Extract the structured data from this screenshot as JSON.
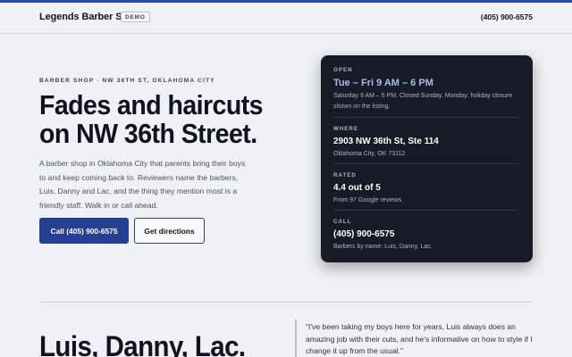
{
  "header": {
    "brand": "Legends Barber Studio",
    "badge": "DEMO",
    "phone": "(405) 900-6575"
  },
  "hero": {
    "eyebrow": "BARBER SHOP · NW 36TH ST, OKLAHOMA CITY",
    "headline": "Fades and haircuts on NW 36th Street.",
    "intro": "A barber shop in Oklahoma City that parents bring their boys to and keep coming back to. Reviewers name the barbers, Luis, Danny and Lac, and the thing they mention most is a friendly staff. Walk in or call ahead.",
    "call_button": "Call (405) 900-6575",
    "directions_button": "Get directions"
  },
  "card": {
    "open": {
      "label": "OPEN",
      "value": "Tue – Fri 9 AM – 6 PM",
      "detail": "Saturday 9 AM – 5 PM. Closed Sunday. Monday: holiday closure shown on the listing."
    },
    "where": {
      "label": "WHERE",
      "value": "2903 NW 36th St, Ste 114",
      "detail": "Oklahoma City, OK 73112"
    },
    "rated": {
      "label": "RATED",
      "value": "4.4 out of 5",
      "detail": "From 97 Google reviews"
    },
    "call": {
      "label": "CALL",
      "value": "(405) 900-6575",
      "detail": "Barbers by name: Luis, Danny, Lac."
    }
  },
  "barbers": {
    "heading": "Luis, Danny, Lac.",
    "quote": "\"I've been taking my boys here for years, Luis always does an amazing job with their cuts, and he's informative on how to style if I change it up from the usual.\""
  },
  "colors": {
    "accent": "#253f93",
    "card_bg": "#161b25",
    "hours_highlight": "#a9bdf5"
  }
}
